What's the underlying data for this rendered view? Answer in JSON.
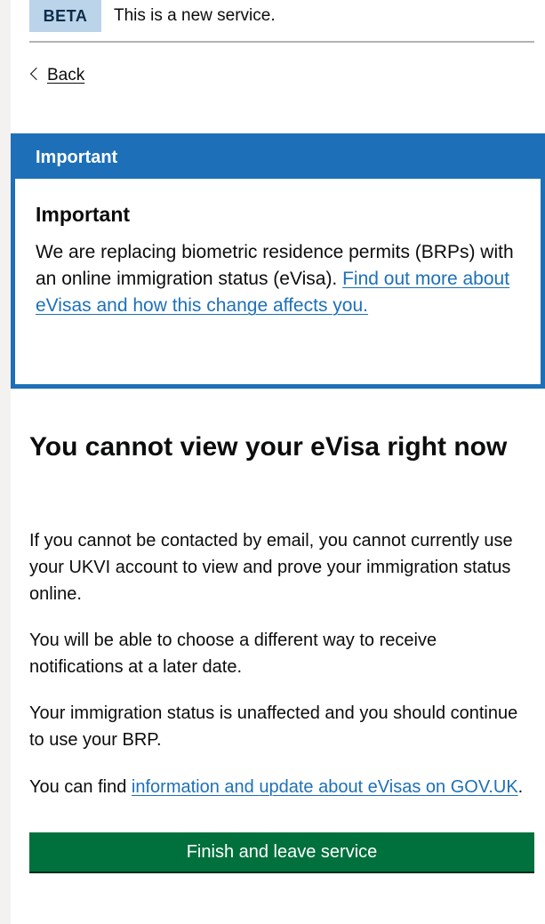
{
  "phase_banner": {
    "tag": "BETA",
    "text": "This is a new service."
  },
  "back_link": {
    "label": "Back"
  },
  "notification": {
    "title": "Important",
    "heading": "Important",
    "body_prefix": "We are replacing biometric residence permits (BRPs) with an online immigration status (eVisa). ",
    "link_text": "Find out more about eVisas and how this change affects you."
  },
  "main": {
    "heading": "You cannot view your eVisa right now",
    "paragraphs": [
      "If you cannot be contacted by email, you cannot currently use your UKVI account to view and prove your immigration status online.",
      "You will be able to choose a different way to receive notifications at a later date.",
      "Your immigration status is unaffected and you should continue to use your BRP."
    ],
    "info_prefix": "You can find ",
    "info_link": "information and update about eVisas on GOV.UK",
    "info_suffix": "."
  },
  "button": {
    "label": "Finish and leave service"
  },
  "colors": {
    "brand_blue": "#1d70b8",
    "button_green": "#00703c",
    "phase_tag_bg": "#bbd4ea",
    "text": "#0b0c0c"
  }
}
